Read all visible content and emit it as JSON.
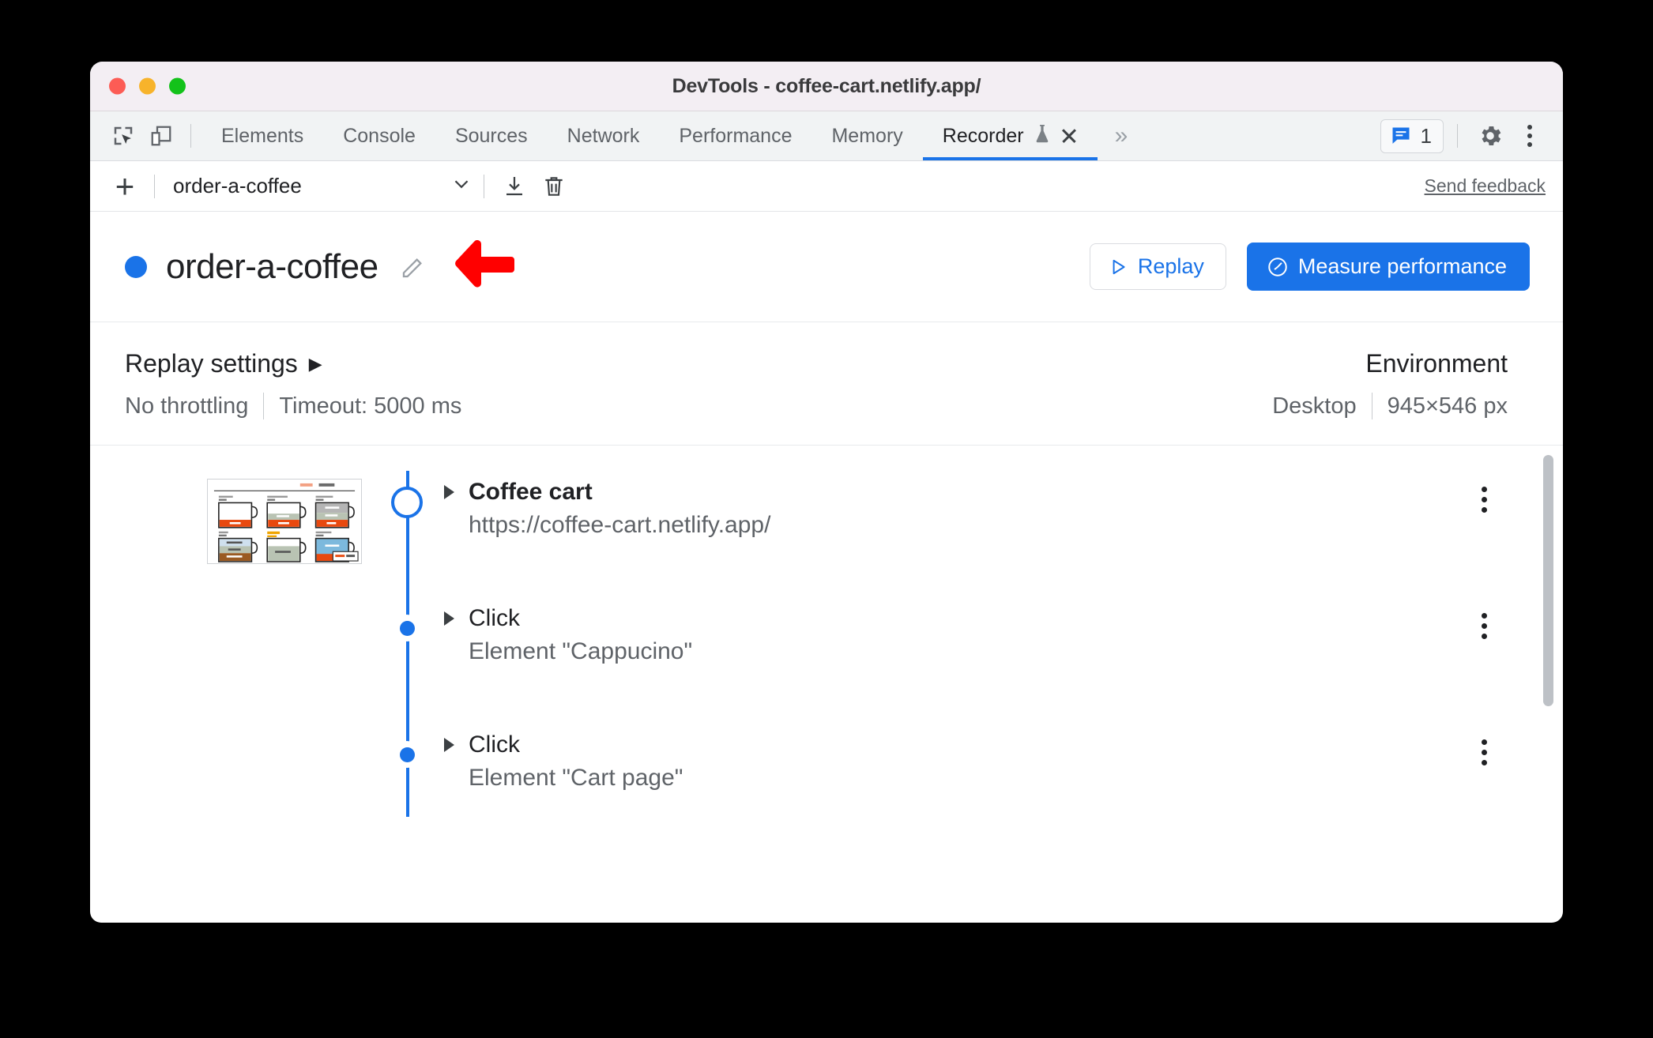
{
  "window": {
    "title": "DevTools - coffee-cart.netlify.app/",
    "traffic_lights": [
      "close-red",
      "minimize-yellow",
      "zoom-green"
    ],
    "colors": {
      "accent": "#1a73e8",
      "titlebar": "#f3eef3",
      "tabstrip": "#f1f3f4",
      "annotation_arrow": "#ff0000"
    }
  },
  "tabstrip": {
    "inspect_icon": "inspect-element-icon",
    "device_icon": "device-toolbar-icon",
    "tabs": [
      {
        "label": "Elements",
        "selected": false
      },
      {
        "label": "Console",
        "selected": false
      },
      {
        "label": "Sources",
        "selected": false
      },
      {
        "label": "Network",
        "selected": false
      },
      {
        "label": "Performance",
        "selected": false
      },
      {
        "label": "Memory",
        "selected": false
      },
      {
        "label": "Recorder",
        "selected": true,
        "experimental_icon": "flask-icon",
        "closeable": true
      }
    ],
    "more_tabs_label": "»",
    "issues_badge": {
      "icon": "message-icon",
      "count": "1"
    },
    "settings_icon": "gear-icon",
    "main_menu_icon": "kebab-menu-icon"
  },
  "recorder_toolbar": {
    "add_label": "+",
    "add_icon": "plus-icon",
    "selected_recording": "order-a-coffee",
    "dropdown_icon": "chevron-down-icon",
    "export_icon": "download-icon",
    "delete_icon": "trash-icon",
    "feedback_label": "Send feedback"
  },
  "recording_header": {
    "status_dot": "recording-dot",
    "title": "order-a-coffee",
    "edit_icon": "pencil-icon",
    "annotation_icon": "red-left-arrow-icon",
    "replay_button": {
      "label": "Replay",
      "icon": "play-icon"
    },
    "measure_button": {
      "label": "Measure performance",
      "icon": "performance-gauge-icon"
    }
  },
  "settings": {
    "replay": {
      "title": "Replay settings",
      "expand_icon": "triangle-right-icon",
      "throttling": "No throttling",
      "timeout": "Timeout: 5000 ms"
    },
    "environment": {
      "title": "Environment",
      "device": "Desktop",
      "viewport": "945×546 px"
    }
  },
  "steps": {
    "thumbnail_alt": "coffee-cart-page-thumbnail",
    "row_menu_icon": "kebab-menu-icon",
    "items": [
      {
        "type": "navigate",
        "title": "Coffee cart",
        "subtitle": "https://coffee-cart.netlify.app/",
        "node": "ring",
        "bold": true,
        "has_thumbnail": true
      },
      {
        "type": "click",
        "title": "Click",
        "subtitle": "Element \"Cappucino\"",
        "node": "dot",
        "bold": false,
        "has_thumbnail": false
      },
      {
        "type": "click",
        "title": "Click",
        "subtitle": "Element \"Cart page\"",
        "node": "dot",
        "bold": false,
        "has_thumbnail": false
      }
    ]
  }
}
